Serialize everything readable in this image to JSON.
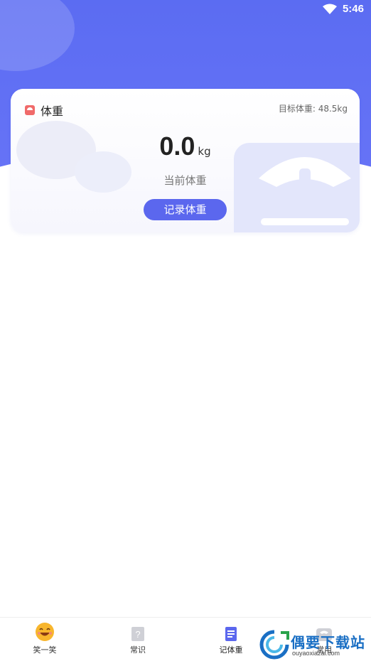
{
  "status_bar": {
    "time": "5:46",
    "icons": [
      "wifi-icon"
    ]
  },
  "card": {
    "title": "体重",
    "title_icon": "scale-icon",
    "target_label": "目标体重: 48.5kg",
    "current_value": "0.0",
    "unit": "kg",
    "current_label": "当前体重",
    "record_button": "记录体重"
  },
  "bottom_nav": {
    "items": [
      {
        "label": "笑一笑",
        "icon": "smile-emoji-icon",
        "active": false
      },
      {
        "label": "常识",
        "icon": "question-book-icon",
        "active": false
      },
      {
        "label": "记体重",
        "icon": "notebook-icon",
        "active": true
      },
      {
        "label": "常用",
        "icon": "scale-icon",
        "active": false
      }
    ]
  },
  "watermark": {
    "title": "偶要下载站",
    "subtitle": "ouyaoxiazai.com"
  },
  "colors": {
    "primary": "#5b67ee",
    "hero": "#5b6cf2",
    "title_icon": "#f06a6a"
  }
}
